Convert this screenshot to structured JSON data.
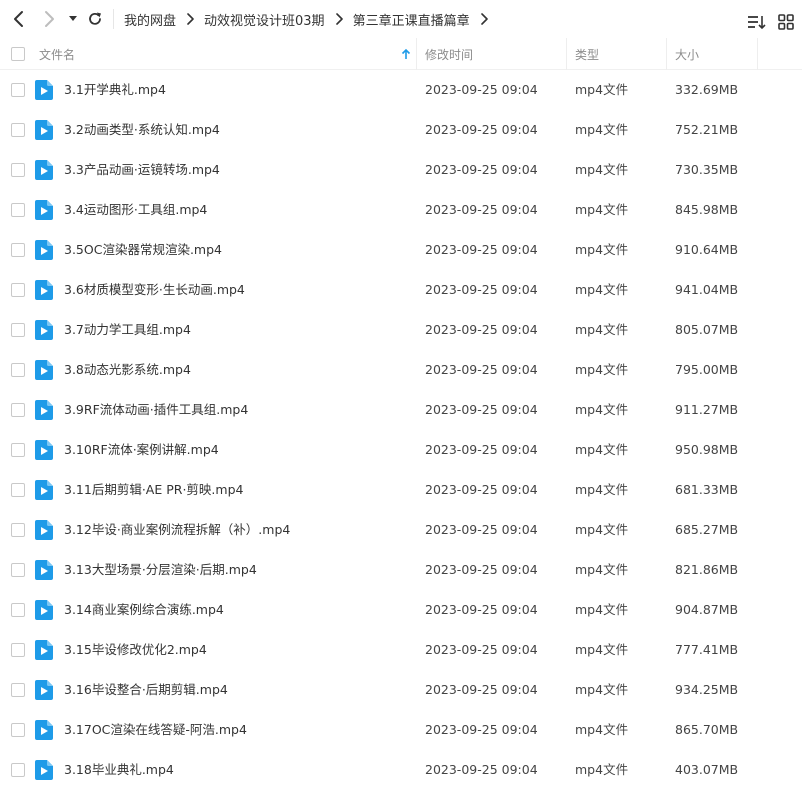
{
  "nav": {
    "back_icon": "chevron-left-icon",
    "forward_icon": "chevron-right-icon",
    "history_icon": "caret-down-icon",
    "refresh_icon": "refresh-icon"
  },
  "breadcrumb": [
    "我的网盘",
    "动效视觉设计班03期",
    "第三章正课直播篇章"
  ],
  "toolbar": {
    "sort_icon": "sort-list-icon",
    "grid_icon": "grid-view-icon"
  },
  "columns": {
    "name": "文件名",
    "modified": "修改时间",
    "type": "类型",
    "size": "大小"
  },
  "sort_indicator": "arrow-up-icon",
  "colors": {
    "accent": "#1e9be8",
    "text": "#333333",
    "header_text": "#8c8c8c"
  },
  "files": [
    {
      "name": "3.1开学典礼.mp4",
      "modified": "2023-09-25 09:04",
      "type": "mp4文件",
      "size": "332.69MB"
    },
    {
      "name": "3.2动画类型·系统认知.mp4",
      "modified": "2023-09-25 09:04",
      "type": "mp4文件",
      "size": "752.21MB"
    },
    {
      "name": "3.3产品动画·运镜转场.mp4",
      "modified": "2023-09-25 09:04",
      "type": "mp4文件",
      "size": "730.35MB"
    },
    {
      "name": "3.4运动图形·工具组.mp4",
      "modified": "2023-09-25 09:04",
      "type": "mp4文件",
      "size": "845.98MB"
    },
    {
      "name": "3.5OC渲染器常规渲染.mp4",
      "modified": "2023-09-25 09:04",
      "type": "mp4文件",
      "size": "910.64MB"
    },
    {
      "name": "3.6材质模型变形·生长动画.mp4",
      "modified": "2023-09-25 09:04",
      "type": "mp4文件",
      "size": "941.04MB"
    },
    {
      "name": "3.7动力学工具组.mp4",
      "modified": "2023-09-25 09:04",
      "type": "mp4文件",
      "size": "805.07MB"
    },
    {
      "name": "3.8动态光影系统.mp4",
      "modified": "2023-09-25 09:04",
      "type": "mp4文件",
      "size": "795.00MB"
    },
    {
      "name": "3.9RF流体动画·插件工具组.mp4",
      "modified": "2023-09-25 09:04",
      "type": "mp4文件",
      "size": "911.27MB"
    },
    {
      "name": "3.10RF流体·案例讲解.mp4",
      "modified": "2023-09-25 09:04",
      "type": "mp4文件",
      "size": "950.98MB"
    },
    {
      "name": "3.11后期剪辑·AE PR·剪映.mp4",
      "modified": "2023-09-25 09:04",
      "type": "mp4文件",
      "size": "681.33MB"
    },
    {
      "name": "3.12毕设·商业案例流程拆解（补）.mp4",
      "modified": "2023-09-25 09:04",
      "type": "mp4文件",
      "size": "685.27MB"
    },
    {
      "name": "3.13大型场景·分层渲染·后期.mp4",
      "modified": "2023-09-25 09:04",
      "type": "mp4文件",
      "size": "821.86MB"
    },
    {
      "name": "3.14商业案例综合演练.mp4",
      "modified": "2023-09-25 09:04",
      "type": "mp4文件",
      "size": "904.87MB"
    },
    {
      "name": "3.15毕设修改优化2.mp4",
      "modified": "2023-09-25 09:04",
      "type": "mp4文件",
      "size": "777.41MB"
    },
    {
      "name": "3.16毕设整合·后期剪辑.mp4",
      "modified": "2023-09-25 09:04",
      "type": "mp4文件",
      "size": "934.25MB"
    },
    {
      "name": "3.17OC渲染在线答疑-阿浩.mp4",
      "modified": "2023-09-25 09:04",
      "type": "mp4文件",
      "size": "865.70MB"
    },
    {
      "name": "3.18毕业典礼.mp4",
      "modified": "2023-09-25 09:04",
      "type": "mp4文件",
      "size": "403.07MB"
    }
  ]
}
